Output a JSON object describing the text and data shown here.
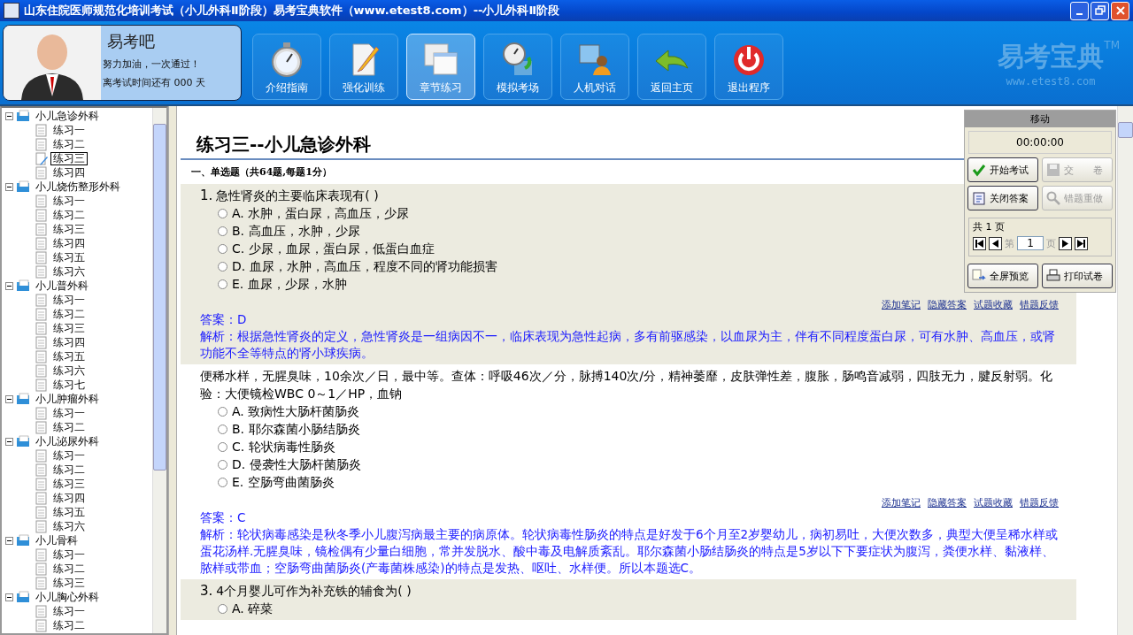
{
  "window": {
    "title": "山东住院医师规范化培训考试（小儿外科Ⅱ阶段）易考宝典软件（www.etest8.com）--小儿外科Ⅱ阶段"
  },
  "profile": {
    "name": "易考吧",
    "slogan": "努力加油，一次通过！",
    "countdown": "离考试时间还有 000 天"
  },
  "toolbar": [
    {
      "kind": "stopwatch",
      "label": "介绍指南",
      "selected": false
    },
    {
      "kind": "pencil",
      "label": "强化训练",
      "selected": false
    },
    {
      "kind": "windows",
      "label": "章节练习",
      "selected": true
    },
    {
      "kind": "clock",
      "label": "模拟考场",
      "selected": false
    },
    {
      "kind": "person",
      "label": "人机对话",
      "selected": false
    },
    {
      "kind": "back",
      "label": "返回主页",
      "selected": false
    },
    {
      "kind": "power",
      "label": "退出程序",
      "selected": false
    }
  ],
  "brand": {
    "logo": "易考宝典",
    "tm": "TM",
    "url": "www.etest8.com"
  },
  "tree": [
    {
      "label": "小儿急诊外科",
      "expanded": true,
      "children": [
        {
          "label": "练习一",
          "selected": false
        },
        {
          "label": "练习二",
          "selected": false
        },
        {
          "label": "练习三",
          "selected": true
        },
        {
          "label": "练习四",
          "selected": false
        }
      ]
    },
    {
      "label": "小儿烧伤整形外科",
      "expanded": true,
      "children": [
        {
          "label": "练习一",
          "selected": false
        },
        {
          "label": "练习二",
          "selected": false
        },
        {
          "label": "练习三",
          "selected": false
        },
        {
          "label": "练习四",
          "selected": false
        },
        {
          "label": "练习五",
          "selected": false
        },
        {
          "label": "练习六",
          "selected": false
        }
      ]
    },
    {
      "label": "小儿普外科",
      "expanded": true,
      "children": [
        {
          "label": "练习一",
          "selected": false
        },
        {
          "label": "练习二",
          "selected": false
        },
        {
          "label": "练习三",
          "selected": false
        },
        {
          "label": "练习四",
          "selected": false
        },
        {
          "label": "练习五",
          "selected": false
        },
        {
          "label": "练习六",
          "selected": false
        },
        {
          "label": "练习七",
          "selected": false
        }
      ]
    },
    {
      "label": "小儿肿瘤外科",
      "expanded": true,
      "children": [
        {
          "label": "练习一",
          "selected": false
        },
        {
          "label": "练习二",
          "selected": false
        }
      ]
    },
    {
      "label": "小儿泌尿外科",
      "expanded": true,
      "children": [
        {
          "label": "练习一",
          "selected": false
        },
        {
          "label": "练习二",
          "selected": false
        },
        {
          "label": "练习三",
          "selected": false
        },
        {
          "label": "练习四",
          "selected": false
        },
        {
          "label": "练习五",
          "selected": false
        },
        {
          "label": "练习六",
          "selected": false
        }
      ]
    },
    {
      "label": "小儿骨科",
      "expanded": true,
      "children": [
        {
          "label": "练习一",
          "selected": false
        },
        {
          "label": "练习二",
          "selected": false
        },
        {
          "label": "练习三",
          "selected": false
        }
      ]
    },
    {
      "label": "小儿胸心外科",
      "expanded": true,
      "children": [
        {
          "label": "练习一",
          "selected": false
        },
        {
          "label": "练习二",
          "selected": false
        }
      ]
    }
  ],
  "exercise": {
    "title": "练习三--小儿急诊外科",
    "section": "一、单选题（共64题,每题1分）",
    "questions": [
      {
        "number": "1.",
        "stem": "急性肾炎的主要临床表现有( )",
        "options": [
          {
            "text": "A. 水肿，蛋白尿，高血压，少尿",
            "selected": false
          },
          {
            "text": "B. 高血压，水肿，少尿",
            "selected": false
          },
          {
            "text": "C. 少尿，血尿，蛋白尿，低蛋白血症",
            "selected": false
          },
          {
            "text": "D. 血尿，水肿，高血压，程度不同的肾功能损害",
            "selected": false
          },
          {
            "text": "E. 血尿，少尿，水肿",
            "selected": false
          }
        ],
        "links": [
          "添加笔记",
          "隐藏答案",
          "试题收藏",
          "错题反馈"
        ],
        "answer": "答案：D",
        "analysis": "解析：根据急性肾炎的定义，急性肾炎是一组病因不一，临床表现为急性起病，多有前驱感染，以血尿为主，伴有不同程度蛋白尿，可有水肿、高血压，或肾功能不全等特点的肾小球疾病。"
      },
      {
        "stem": "便稀水样，无腥臭味，10余次／日，最中等。查体：呼吸46次／分，脉搏140次/分，精神萎靡，皮肤弹性差，腹胀，肠鸣音减弱，四肢无力，腱反射弱。化验：大便镜检WBC 0～1／HP，血钠",
        "options": [
          {
            "text": "A. 致病性大肠杆菌肠炎",
            "selected": false
          },
          {
            "text": "B. 耶尔森菌小肠结肠炎",
            "selected": false
          },
          {
            "text": "C. 轮状病毒性肠炎",
            "selected": false
          },
          {
            "text": "D. 侵袭性大肠杆菌肠炎",
            "selected": false
          },
          {
            "text": "E. 空肠弯曲菌肠炎",
            "selected": false
          }
        ],
        "links": [
          "添加笔记",
          "隐藏答案",
          "试题收藏",
          "错题反馈"
        ],
        "answer": "答案：C",
        "analysis": "解析：轮状病毒感染是秋冬季小儿腹泻病最主要的病原体。轮状病毒性肠炎的特点是好发于6个月至2岁婴幼儿，病初易吐，大便次数多，典型大便呈稀水样或蛋花汤样.无腥臭味，镜检偶有少量白细胞，常并发脱水、酸中毒及电解质紊乱。耶尔森菌小肠结肠炎的特点是5岁以下下要症状为腹泻，粪便水样、黏液样、脓样或带血；空肠弯曲菌肠炎(产毒菌株感染)的特点是发热、呕吐、水样便。所以本题选C。"
      },
      {
        "number": "3.",
        "stem": "4个月婴儿可作为补充铁的辅食为( )",
        "options": [
          {
            "text": "A. 碎菜",
            "selected": false
          }
        ]
      }
    ]
  },
  "panel": {
    "header": "移动",
    "timer": "00:00:00",
    "buttons": [
      {
        "kind": "check",
        "label": "开始考试",
        "disabled": false
      },
      {
        "kind": "disk",
        "label": "交　　卷",
        "disabled": true
      },
      {
        "kind": "note",
        "label": "关闭答案",
        "disabled": false
      },
      {
        "kind": "magnifier",
        "label": "错题重做",
        "disabled": true
      }
    ],
    "pager": {
      "total": "共 1 页",
      "prefix": "第",
      "page": "1",
      "suffix": "页"
    },
    "actions": [
      {
        "kind": "preview",
        "label": "全屏预览"
      },
      {
        "kind": "printer",
        "label": "打印试卷"
      }
    ]
  }
}
